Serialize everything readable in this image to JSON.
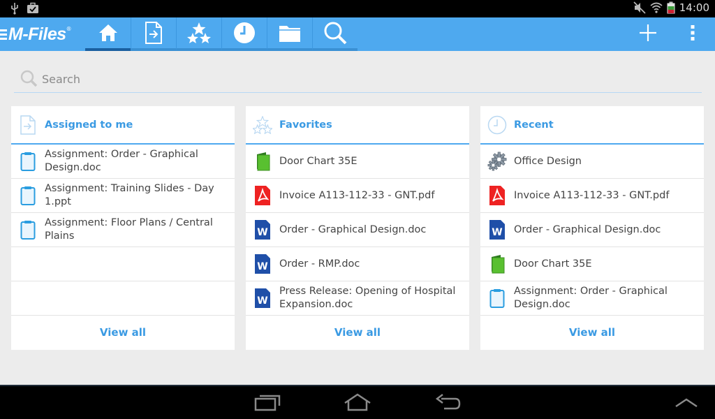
{
  "status": {
    "time": "14:00"
  },
  "app": {
    "logo": "M-Files",
    "logo_mark": "®"
  },
  "tabs": [
    {
      "name": "home",
      "icon": "home-icon",
      "active": true
    },
    {
      "name": "assigned",
      "icon": "assigned-icon"
    },
    {
      "name": "favorites",
      "icon": "star-icon"
    },
    {
      "name": "recent",
      "icon": "clock-icon"
    },
    {
      "name": "browse",
      "icon": "folder-icon"
    },
    {
      "name": "search",
      "icon": "search-icon"
    }
  ],
  "search": {
    "placeholder": "Search"
  },
  "cards": {
    "assigned": {
      "title": "Assigned to me",
      "items": [
        {
          "label": "Assignment: Order - Graphical Design.doc",
          "icon": "assignment-icon"
        },
        {
          "label": "Assignment: Training Slides - Day 1.ppt",
          "icon": "assignment-icon"
        },
        {
          "label": "Assignment: Floor Plans / Central Plains",
          "icon": "assignment-icon"
        }
      ],
      "view_all": "View all"
    },
    "favorites": {
      "title": "Favorites",
      "items": [
        {
          "label": "Door Chart 35E",
          "icon": "green-book-icon"
        },
        {
          "label": "Invoice A113-112-33 - GNT.pdf",
          "icon": "pdf-icon"
        },
        {
          "label": "Order - Graphical Design.doc",
          "icon": "word-icon"
        },
        {
          "label": "Order - RMP.doc",
          "icon": "word-icon"
        },
        {
          "label": "Press Release: Opening of Hospital Expansion.doc",
          "icon": "word-icon"
        }
      ],
      "view_all": "View all"
    },
    "recent": {
      "title": "Recent",
      "items": [
        {
          "label": "Office Design",
          "icon": "gears-icon"
        },
        {
          "label": "Invoice A113-112-33 - GNT.pdf",
          "icon": "pdf-icon"
        },
        {
          "label": "Order - Graphical Design.doc",
          "icon": "word-icon"
        },
        {
          "label": "Door Chart 35E",
          "icon": "green-book-icon"
        },
        {
          "label": "Assignment: Order - Graphical Design.doc",
          "icon": "assignment-icon"
        }
      ],
      "view_all": "View all"
    }
  },
  "colors": {
    "accent": "#4ea9ef",
    "link": "#3a9ae3",
    "background": "#ececec"
  }
}
